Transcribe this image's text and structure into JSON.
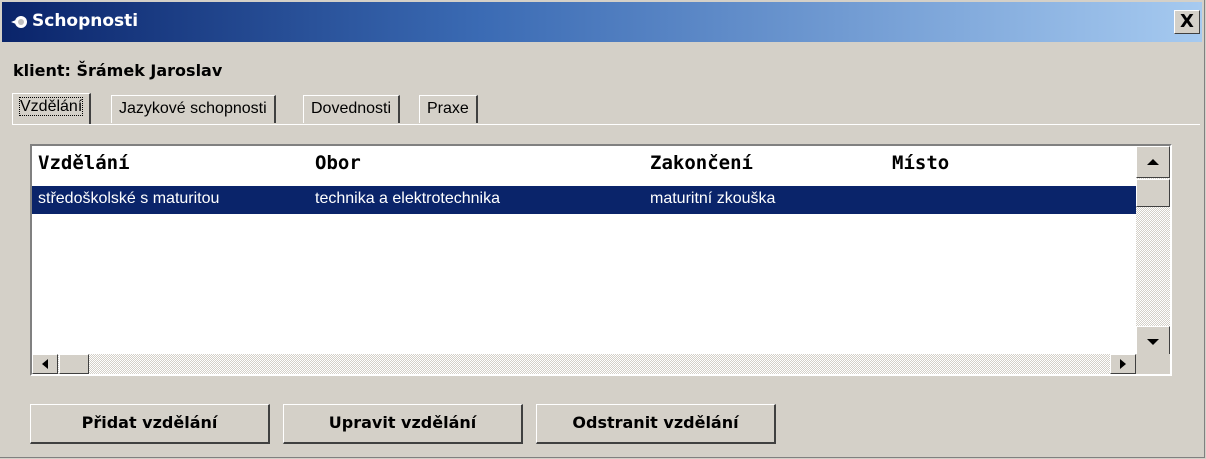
{
  "window": {
    "title": "Schopnosti",
    "close_label": "X"
  },
  "client_label": "klient: Šrámek Jaroslav",
  "tabs": [
    {
      "label": "Vzdělání",
      "active": true
    },
    {
      "label": "Jazykové schopnosti",
      "active": false
    },
    {
      "label": "Dovednosti",
      "active": false
    },
    {
      "label": "Praxe",
      "active": false
    }
  ],
  "list": {
    "columns": [
      "Vzdělání",
      "Obor",
      "Zakončení",
      "Místo"
    ],
    "rows": [
      [
        "středoškolské s maturitou",
        "technika a elektrotechnika",
        "maturitní zkouška",
        ""
      ]
    ],
    "selected_row": 0
  },
  "buttons": {
    "add": "Přidat vzdělání",
    "edit": "Upravit vzdělání",
    "remove": "Odstranit vzdělání"
  },
  "colors": {
    "title_start": "#0a246a",
    "title_end": "#a6caf0",
    "selection": "#0a246a",
    "face": "#d4d0c8"
  },
  "icons": {
    "window": "app-icon",
    "close": "close-icon"
  }
}
